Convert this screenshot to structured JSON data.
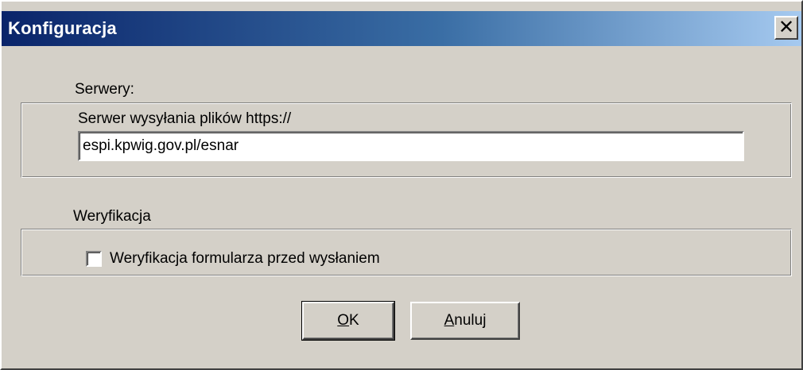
{
  "window": {
    "title": "Konfiguracja",
    "close_glyph": "✕",
    "close_icon": "close-x-icon"
  },
  "servers_group": {
    "label": "Serwery:",
    "upload_server_label": "Serwer wysyłania plików https://",
    "upload_server_value": "espi.kpwig.gov.pl/esnar"
  },
  "verification_group": {
    "label": "Weryfikacja",
    "checkbox_label": "Weryfikacja formularza przed wysłaniem",
    "checkbox_checked": false
  },
  "buttons": {
    "ok_mnemonic": "O",
    "ok_rest": "K",
    "cancel_mnemonic": "A",
    "cancel_rest": "nuluj"
  },
  "colors": {
    "dialog_face": "#d4d0c8",
    "title_gradient_start": "#0a246a",
    "title_gradient_end": "#a6caf0",
    "title_text": "#ffffff"
  }
}
